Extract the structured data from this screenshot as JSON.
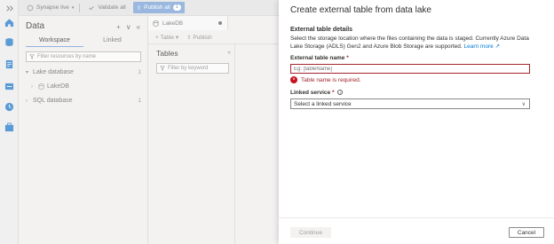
{
  "toolbar": {
    "synapse_live": "Synapse live",
    "validate_all": "Validate all",
    "publish_all": "Publish all",
    "publish_count": "1"
  },
  "data_pane": {
    "title": "Data",
    "tabs": [
      "Workspace",
      "Linked"
    ],
    "filter_placeholder": "Filter resources by name",
    "tree": [
      {
        "label": "Lake database",
        "count": "1"
      },
      {
        "label": "LakeDB",
        "count": ""
      },
      {
        "label": "SQL database",
        "count": "1"
      }
    ]
  },
  "editor": {
    "tab_label": "LakeDB",
    "table_button": "Table",
    "publish_button": "Publish",
    "tables_title": "Tables",
    "keyword_placeholder": "Filter by keyword"
  },
  "flyout": {
    "title": "Create external table from data lake",
    "section_header": "External table details",
    "description": "Select the storage location where the files containing the data is staged. Currently Azure Data Lake Storage (ADLS) Gen2 and Azure Blob Storage are supported.",
    "learn_more": "Learn more",
    "table_name_label": "External table name",
    "table_name_placeholder": "Eg: [tableName]",
    "table_name_error": "Table name is required.",
    "linked_service_label": "Linked service",
    "linked_service_value": "Select a linked service",
    "continue_label": "Continue",
    "cancel_label": "Cancel",
    "required_mark": "*"
  },
  "colors": {
    "accent": "#0078d4",
    "error": "#a4262c"
  },
  "rail_icons": [
    "home-icon",
    "data-icon",
    "develop-icon",
    "integrate-icon",
    "monitor-icon",
    "manage-icon"
  ]
}
